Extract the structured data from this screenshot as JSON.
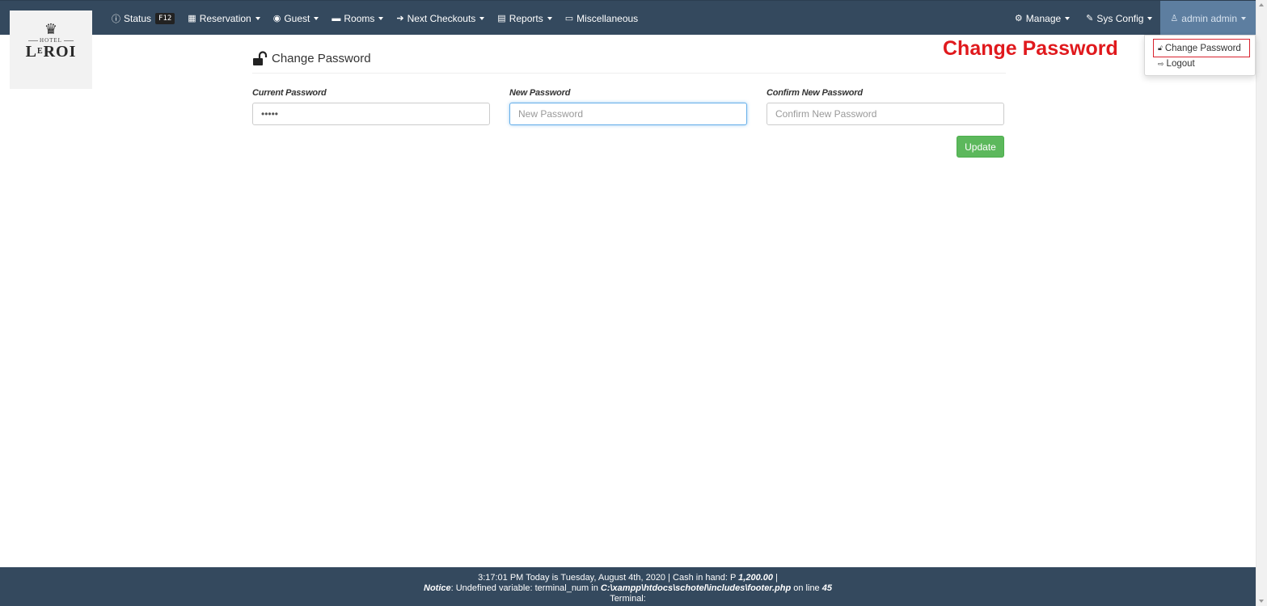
{
  "logo": {
    "crown": "♛",
    "hotel": "HOTEL",
    "brand_first": "L",
    "brand_sup": "E",
    "brand_rest": "ROI"
  },
  "nav": {
    "status": {
      "label": "Status",
      "kbd": "F12"
    },
    "reservation": "Reservation",
    "guest": "Guest",
    "rooms": "Rooms",
    "next_checkouts": "Next Checkouts",
    "reports": "Reports",
    "misc": "Miscellaneous",
    "manage": "Manage",
    "sys_config": "Sys Config",
    "user": "admin admin"
  },
  "page": {
    "title": "Change Password"
  },
  "form": {
    "current": {
      "label": "Current Password",
      "value": "•••••"
    },
    "new": {
      "label": "New Password",
      "placeholder": "New Password"
    },
    "confirm": {
      "label": "Confirm New Password",
      "placeholder": "Confirm New Password"
    },
    "update": "Update"
  },
  "annotation": "Change Password",
  "dropdown": {
    "change_password": "Change Password",
    "logout": "Logout"
  },
  "footer": {
    "line1_pre": "3:17:01 PM Today is Tuesday, August 4th, 2020 | Cash in hand: P ",
    "cash": "1,200.00",
    "line1_post": " |",
    "notice_label": "Notice",
    "notice_pre": ": Undefined variable: terminal_num in ",
    "notice_path": "C:\\xampp\\htdocs\\schotel\\includes\\footer.php",
    "notice_mid": " on line ",
    "notice_line": "45",
    "terminal": "Terminal:"
  },
  "colors": {
    "navbar": "#34495e",
    "update_button": "#5cb85c",
    "annotation": "#e0191d",
    "user_menu": "#5d7ea0"
  }
}
